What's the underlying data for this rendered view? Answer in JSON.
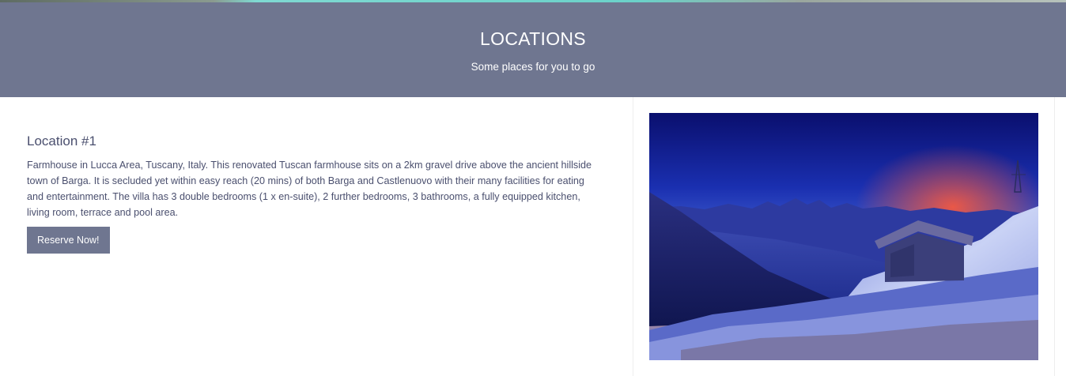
{
  "header": {
    "title": "LOCATIONS",
    "subtitle": "Some places for you to go"
  },
  "location": {
    "title": "Location #1",
    "description": "Farmhouse in Lucca Area, Tuscany, Italy. This renovated Tuscan farmhouse sits on a 2km gravel drive above the ancient hillside town of Barga. It is secluded yet within easy reach (20 mins) of both Barga and Castlenuovo with their many facilities for eating and entertainment. The villa has 3 double bedrooms (1 x en-suite), 2 further bedrooms, 3 bathrooms, a fully equipped kitchen, living room, terrace and pool area.",
    "reserve_label": "Reserve Now!"
  },
  "colors": {
    "header_bg": "#6f7690",
    "text": "#4a4f6e",
    "button_bg": "#6f7690"
  }
}
